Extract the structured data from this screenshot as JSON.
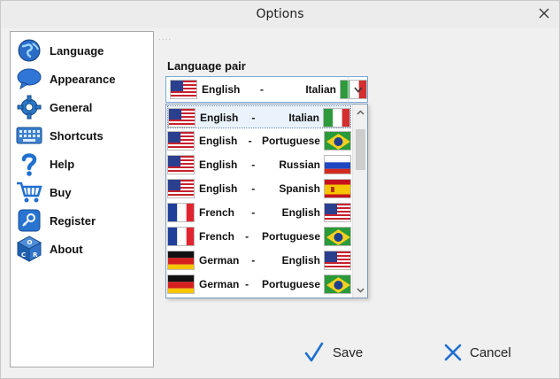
{
  "window": {
    "title": "Options"
  },
  "sidebar": {
    "items": [
      {
        "label": "Language",
        "icon": "globe-icon"
      },
      {
        "label": "Appearance",
        "icon": "speech-bubble-icon"
      },
      {
        "label": "General",
        "icon": "gear-icon"
      },
      {
        "label": "Shortcuts",
        "icon": "keyboard-icon"
      },
      {
        "label": "Help",
        "icon": "question-mark-icon"
      },
      {
        "label": "Buy",
        "icon": "shopping-cart-icon"
      },
      {
        "label": "Register",
        "icon": "key-icon"
      },
      {
        "label": "About",
        "icon": "cube-icon"
      }
    ]
  },
  "language_pair": {
    "label": "Language pair",
    "selected": {
      "from": "English",
      "sep": "-",
      "to": "Italian",
      "from_flag": "us",
      "to_flag": "it"
    },
    "options": [
      {
        "from": "English",
        "sep": "-",
        "to": "Italian",
        "from_flag": "us",
        "to_flag": "it"
      },
      {
        "from": "English",
        "sep": "-",
        "to": "Portuguese",
        "from_flag": "us",
        "to_flag": "br"
      },
      {
        "from": "English",
        "sep": "-",
        "to": "Russian",
        "from_flag": "us",
        "to_flag": "ru"
      },
      {
        "from": "English",
        "sep": "-",
        "to": "Spanish",
        "from_flag": "us",
        "to_flag": "es"
      },
      {
        "from": "French",
        "sep": "-",
        "to": "English",
        "from_flag": "fr",
        "to_flag": "us"
      },
      {
        "from": "French",
        "sep": "-",
        "to": "Portuguese",
        "from_flag": "fr",
        "to_flag": "br"
      },
      {
        "from": "German",
        "sep": "-",
        "to": "English",
        "from_flag": "de",
        "to_flag": "us"
      },
      {
        "from": "German",
        "sep": "-",
        "to": "Portuguese",
        "from_flag": "de",
        "to_flag": "br"
      }
    ]
  },
  "footer": {
    "save_label": "Save",
    "cancel_label": "Cancel"
  },
  "colors": {
    "accent": "#1a5fb4",
    "selection": "#eaf3fb"
  }
}
